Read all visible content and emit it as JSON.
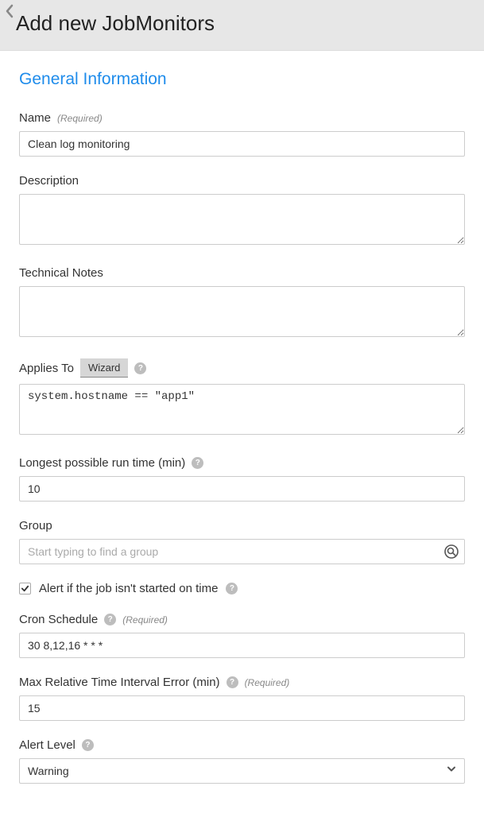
{
  "header": {
    "title": "Add new JobMonitors"
  },
  "section": {
    "title": "General Information"
  },
  "labels": {
    "required": "(Required)"
  },
  "fields": {
    "name": {
      "label": "Name",
      "value": "Clean log monitoring"
    },
    "description": {
      "label": "Description",
      "value": ""
    },
    "technical_notes": {
      "label": "Technical Notes",
      "value": ""
    },
    "applies_to": {
      "label": "Applies To",
      "wizard_label": "Wizard",
      "value": "system.hostname == \"app1\""
    },
    "longest_runtime": {
      "label": "Longest possible run time (min)",
      "value": "10"
    },
    "group": {
      "label": "Group",
      "placeholder": "Start typing to find a group",
      "value": ""
    },
    "alert_checkbox": {
      "label": "Alert if the job isn't started on time",
      "checked": true
    },
    "cron_schedule": {
      "label": "Cron Schedule",
      "value": "30 8,12,16 * * *"
    },
    "max_interval_error": {
      "label": "Max Relative Time Interval Error (min)",
      "value": "15"
    },
    "alert_level": {
      "label": "Alert Level",
      "value": "Warning"
    }
  }
}
